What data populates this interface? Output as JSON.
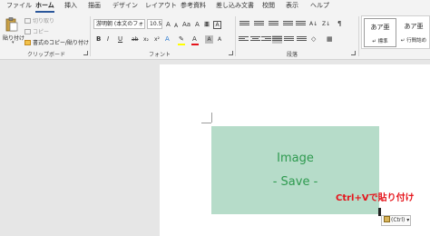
{
  "tabs": [
    "ファイル",
    "ホーム",
    "挿入",
    "描画",
    "デザイン",
    "レイアウト",
    "参考資料",
    "差し込み文書",
    "校閲",
    "表示",
    "ヘルプ"
  ],
  "active_tab_index": 1,
  "clipboard": {
    "paste_label": "貼り付け",
    "cut_label": "切り取り",
    "copy_label": "コピー",
    "format_painter_label": "書式のコピー/貼り付け",
    "group_label": "クリップボード"
  },
  "font": {
    "font_name": "游明朝 (本文のフォント",
    "font_size": "10.5",
    "group_label": "フォント",
    "bold": "B",
    "italic": "I",
    "underline": "U",
    "strikethrough": "ab",
    "subscript": "x₂",
    "superscript": "x²",
    "highlight_color": "#ffff00",
    "font_color": "#e5141b"
  },
  "paragraph": {
    "group_label": "段落"
  },
  "styles": {
    "items": [
      {
        "sample": "あア亜",
        "name": "↵ 標準"
      },
      {
        "sample": "あア亜",
        "name": "↵ 行間詰め"
      }
    ]
  },
  "document": {
    "image_title": "Image",
    "image_subtitle": "- Save -",
    "image_fill": "#b6dcc9",
    "text_color": "#2e9a4f"
  },
  "annotation": {
    "text": "Ctrl+Vで貼り付け",
    "color": "#e5141b"
  },
  "paste_options": {
    "label": "(Ctrl)"
  }
}
